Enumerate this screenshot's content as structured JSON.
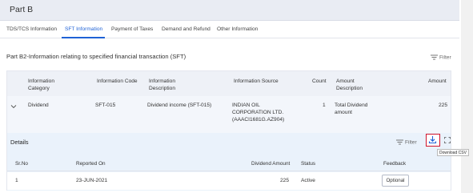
{
  "header": {
    "title": "Part B"
  },
  "tabs": [
    {
      "label": "TDS/TCS Information",
      "active": false
    },
    {
      "label": "SFT Information",
      "active": true
    },
    {
      "label": "Payment of Taxes",
      "active": false
    },
    {
      "label": "Demand and Refund",
      "active": false
    },
    {
      "label": "Other Information",
      "active": false
    }
  ],
  "section": {
    "title": "Part B2-Information relating to specified financial transaction (SFT)",
    "filter_label": "Filter"
  },
  "table": {
    "headers": {
      "category_l1": "Information",
      "category_l2": "Category",
      "code": "Information Code",
      "desc_l1": "Information",
      "desc_l2": "Description",
      "source": "Information Source",
      "count": "Count",
      "amtdesc_l1": "Amount",
      "amtdesc_l2": "Description",
      "amount": "Amount"
    },
    "row": {
      "category": "Dividend",
      "code": "SFT-015",
      "description": "Dividend income (SFT-015)",
      "source_l1": "INDIAN OIL",
      "source_l2": "CORPORATION LTD.",
      "source_l3": "(AAACI1681G.AZ904)",
      "count": "1",
      "amtdesc_l1": "Total Dividend",
      "amtdesc_l2": "amount",
      "amount": "225"
    }
  },
  "details": {
    "title": "Details",
    "filter_label": "Filter",
    "tooltip": "Download CSV",
    "headers": {
      "srno": "Sr.No",
      "reported_on": "Reported On",
      "dividend_amount": "Dividend Amount",
      "status": "Status",
      "feedback": "Feedback"
    },
    "row": {
      "srno": "1",
      "reported_on": "23-JUN-2021",
      "dividend_amount": "225",
      "status": "Active",
      "feedback": "Optional"
    }
  },
  "colors": {
    "accent": "#1f62d6",
    "highlight": "#d0152b"
  }
}
